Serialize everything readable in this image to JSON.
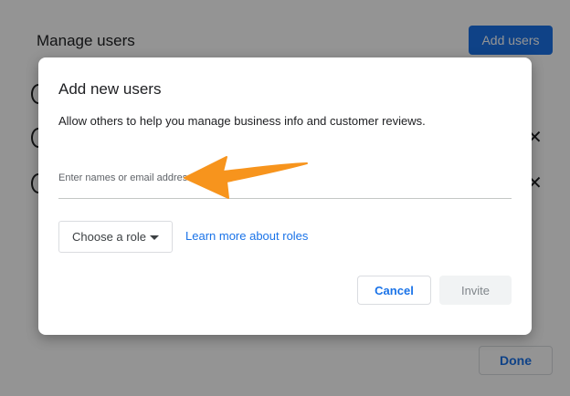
{
  "background": {
    "title": "Manage users",
    "add_users_label": "Add users",
    "done_label": "Done"
  },
  "dialog": {
    "title": "Add new users",
    "description": "Allow others to help you manage business info and customer reviews.",
    "input_placeholder": "Enter names or email addresses",
    "input_value": "",
    "role_select_label": "Choose a role",
    "learn_more_label": "Learn more about roles",
    "cancel_label": "Cancel",
    "invite_label": "Invite"
  },
  "icons": {
    "remove": "close-icon",
    "role_dropdown": "caret-down-icon",
    "annotation": "pointer-arrow-icon"
  },
  "colors": {
    "primary": "#1a73e8",
    "annotation_arrow": "#f7941d",
    "scrim": "rgba(0,0,0,0.42)",
    "disabled_button_bg": "#f1f3f4"
  }
}
